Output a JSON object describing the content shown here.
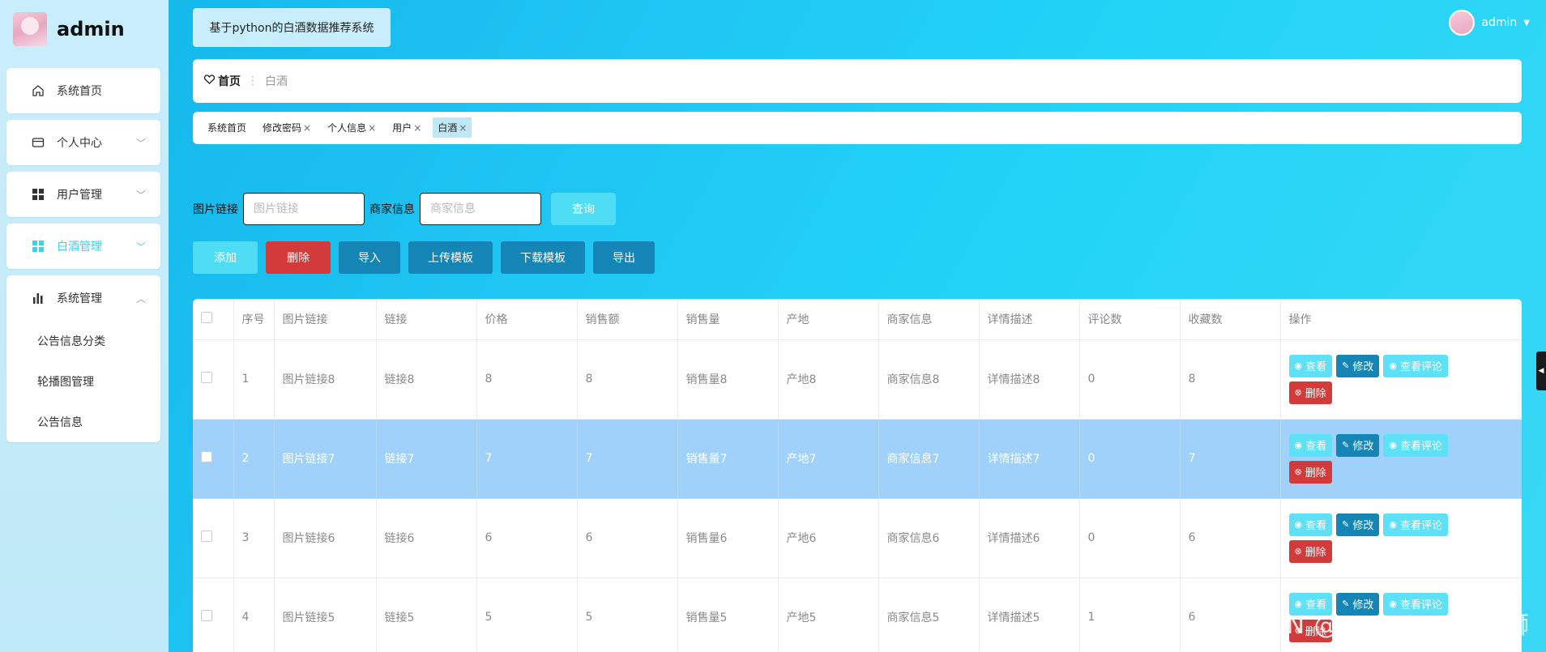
{
  "brand": {
    "name": "admin"
  },
  "sidebar": {
    "items": [
      {
        "label": "系统首页",
        "icon": "home-icon"
      },
      {
        "label": "个人中心",
        "icon": "card-icon",
        "chevron": "﹀"
      },
      {
        "label": "用户管理",
        "icon": "grid-icon",
        "chevron": "﹀"
      },
      {
        "label": "白酒管理",
        "icon": "grid-icon",
        "chevron": "﹀",
        "active": true
      },
      {
        "label": "系统管理",
        "icon": "bar-chart-icon",
        "chevron": "︿",
        "sub": [
          "公告信息分类",
          "轮播图管理",
          "公告信息"
        ]
      }
    ]
  },
  "header": {
    "system_title": "基于python的白酒数据推荐系统",
    "user_name": "admin",
    "caret": "▼"
  },
  "breadcrumb": {
    "home": "首页",
    "sep": "⋮",
    "current": "白酒"
  },
  "tags": [
    {
      "label": "系统首页",
      "closable": false
    },
    {
      "label": "修改密码",
      "closable": true
    },
    {
      "label": "个人信息",
      "closable": true
    },
    {
      "label": "用户",
      "closable": true
    },
    {
      "label": "白酒",
      "closable": true,
      "active": true
    }
  ],
  "tag_close": "×",
  "search": {
    "field1_label": "图片链接",
    "field1_placeholder": "图片链接",
    "field2_label": "商家信息",
    "field2_placeholder": "商家信息",
    "query_label": "查询"
  },
  "actions": {
    "add": "添加",
    "delete": "删除",
    "import": "导入",
    "upload_template": "上传模板",
    "download_template": "下载模板",
    "export": "导出"
  },
  "table": {
    "columns": [
      "序号",
      "图片链接",
      "链接",
      "价格",
      "销售额",
      "销售量",
      "产地",
      "商家信息",
      "详情描述",
      "评论数",
      "收藏数",
      "操作"
    ],
    "rows": [
      {
        "no": "1",
        "img": "图片链接8",
        "link": "链接8",
        "price": "8",
        "sales_amount": "8",
        "sales_volume": "销售量8",
        "origin": "产地8",
        "merchant": "商家信息8",
        "detail": "详情描述8",
        "comments": "0",
        "favorites": "8",
        "selected": false
      },
      {
        "no": "2",
        "img": "图片链接7",
        "link": "链接7",
        "price": "7",
        "sales_amount": "7",
        "sales_volume": "销售量7",
        "origin": "产地7",
        "merchant": "商家信息7",
        "detail": "详情描述7",
        "comments": "0",
        "favorites": "7",
        "selected": true
      },
      {
        "no": "3",
        "img": "图片链接6",
        "link": "链接6",
        "price": "6",
        "sales_amount": "6",
        "sales_volume": "销售量6",
        "origin": "产地6",
        "merchant": "商家信息6",
        "detail": "详情描述6",
        "comments": "0",
        "favorites": "6",
        "selected": false
      },
      {
        "no": "4",
        "img": "图片链接5",
        "link": "链接5",
        "price": "5",
        "sales_amount": "5",
        "sales_volume": "销售量5",
        "origin": "产地5",
        "merchant": "商家信息5",
        "detail": "详情描述5",
        "comments": "1",
        "favorites": "6",
        "selected": false
      }
    ],
    "row_ops": {
      "view": "查看",
      "edit": "修改",
      "comment": "查看评论",
      "remove": "删除"
    }
  },
  "watermark": "CSDN @Java_IoT 攻城狮",
  "colors": {
    "accent": "#4fdcf5",
    "dark_button": "#1585b5",
    "danger": "#d33b3b",
    "selected_row": "#9fd1fb"
  }
}
